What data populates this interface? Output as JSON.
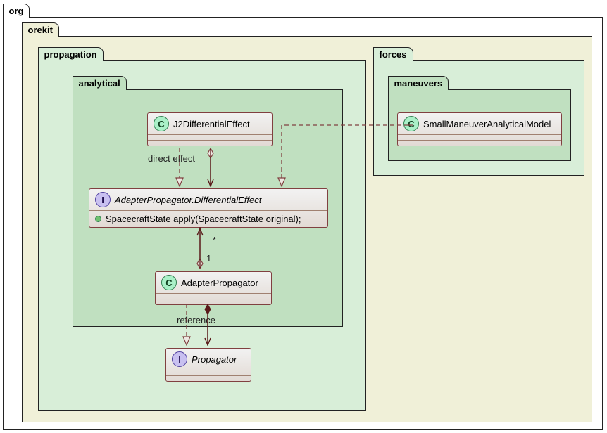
{
  "packages": {
    "org": "org",
    "orekit": "orekit",
    "propagation": "propagation",
    "analytical": "analytical",
    "forces": "forces",
    "maneuvers": "maneuvers"
  },
  "classes": {
    "j2": {
      "badge": "C",
      "name": "J2DifferentialEffect"
    },
    "diffEffect": {
      "badge": "I",
      "name": "AdapterPropagator.DifferentialEffect",
      "method": "SpacecraftState apply(SpacecraftState original);"
    },
    "adapter": {
      "badge": "C",
      "name": "AdapterPropagator"
    },
    "propagator": {
      "badge": "I",
      "name": "Propagator"
    },
    "smam": {
      "badge": "C",
      "name": "SmallManeuverAnalyticalModel"
    }
  },
  "labels": {
    "directEffect": "direct effect",
    "reference": "reference",
    "star": "*",
    "one": "1"
  }
}
